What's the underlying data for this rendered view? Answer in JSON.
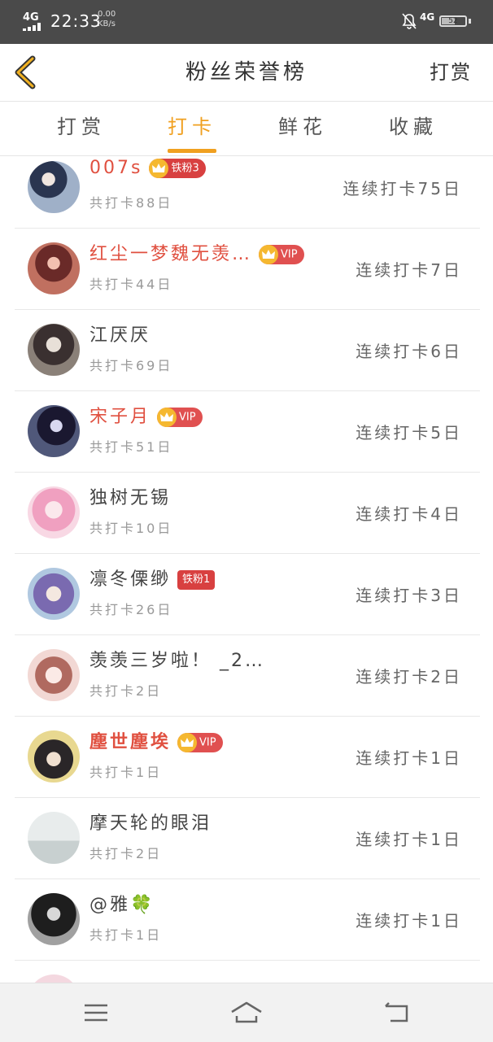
{
  "status_bar": {
    "network": "4G",
    "time": "22:33",
    "speed_value": "0.00",
    "speed_unit": "KB/s",
    "mobile": "4G",
    "battery": "52"
  },
  "header": {
    "title": "粉丝荣誉榜",
    "right_action": "打赏"
  },
  "tabs": [
    {
      "label": "打赏",
      "active": false
    },
    {
      "label": "打卡",
      "active": true
    },
    {
      "label": "鲜花",
      "active": false
    },
    {
      "label": "收藏",
      "active": false
    }
  ],
  "rows": [
    {
      "name": "007s",
      "badge": "铁粉3",
      "total": "共打卡88日",
      "streak": "连续打卡75日"
    },
    {
      "name": "红尘一梦魏无羡…",
      "badge": "VIP",
      "total": "共打卡44日",
      "streak": "连续打卡7日"
    },
    {
      "name": "江厌厌",
      "badge": "",
      "total": "共打卡69日",
      "streak": "连续打卡6日"
    },
    {
      "name": "宋子月",
      "badge": "VIP",
      "total": "共打卡51日",
      "streak": "连续打卡5日"
    },
    {
      "name": "独树无锡",
      "badge": "",
      "total": "共打卡10日",
      "streak": "连续打卡4日"
    },
    {
      "name": "凛冬傈缈",
      "badge": "铁粉1",
      "total": "共打卡26日",
      "streak": "连续打卡3日"
    },
    {
      "name": "羡羡三岁啦！ _2…",
      "badge": "",
      "total": "共打卡2日",
      "streak": "连续打卡2日"
    },
    {
      "name": "塵世塵埃",
      "badge": "VIP",
      "total": "共打卡1日",
      "streak": "连续打卡1日"
    },
    {
      "name": "摩天轮的眼泪",
      "badge": "",
      "total": "共打卡2日",
      "streak": "连续打卡1日"
    },
    {
      "name": "@雅🍀",
      "badge": "",
      "total": "共打卡1日",
      "streak": "连续打卡1日"
    }
  ],
  "colors": {
    "accent": "#f0a020",
    "vip_name": "#e05040",
    "badge_red": "#e05050",
    "status_bar": "#4a4a4a"
  },
  "icons": {
    "back": "chevron-left-icon",
    "bell": "bell-off-icon",
    "menu": "menu-icon",
    "home": "home-icon",
    "back_nav": "return-icon",
    "crown": "crown-icon"
  }
}
